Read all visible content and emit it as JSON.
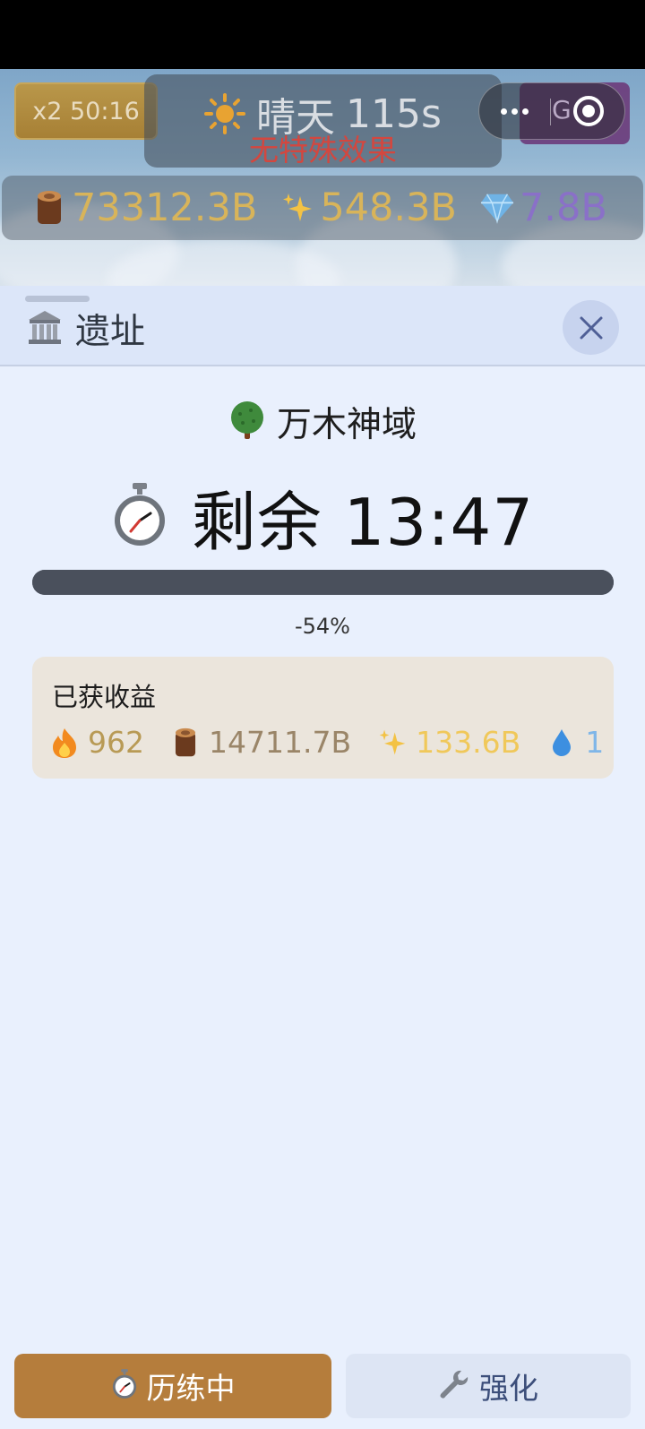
{
  "hud": {
    "boost_label": "x2 50:16",
    "weather": {
      "icon": "sun-icon",
      "name": "晴天",
      "seconds": "115s",
      "effect": "无特殊效果"
    },
    "capsule": {
      "go_label": "G"
    },
    "resources": [
      {
        "icon": "wood-log-icon",
        "value": "73312.3B",
        "color": "#d8b45a"
      },
      {
        "icon": "sparkles-icon",
        "value": "548.3B",
        "color": "#d8b45a"
      },
      {
        "icon": "diamond-icon",
        "value": "7.8B",
        "color": "#8a70c8"
      }
    ]
  },
  "panel": {
    "title": "遗址",
    "title_icon": "temple-icon",
    "realm_icon": "tree-icon",
    "realm_name": "万木神域",
    "timer_icon": "stopwatch-icon",
    "timer_text": "剩余 13:47",
    "progress_label": "-54%",
    "earnings_title": "已获收益",
    "earnings": [
      {
        "icon": "fire-icon",
        "value": "962",
        "color": "#b89a55"
      },
      {
        "icon": "wood-log-icon",
        "value": "14711.7B",
        "color": "#9a8568"
      },
      {
        "icon": "sparkles-icon",
        "value": "133.6B",
        "color": "#f0c85a"
      },
      {
        "icon": "water-drop-icon",
        "value": "1",
        "color": "#7fb6e8"
      }
    ]
  },
  "footer": {
    "primary_label": "历练中",
    "secondary_label": "强化"
  },
  "colors": {
    "primary_button": "#b57d3c",
    "secondary_button": "#dde5f4",
    "panel_bg": "#e9f0fd"
  }
}
